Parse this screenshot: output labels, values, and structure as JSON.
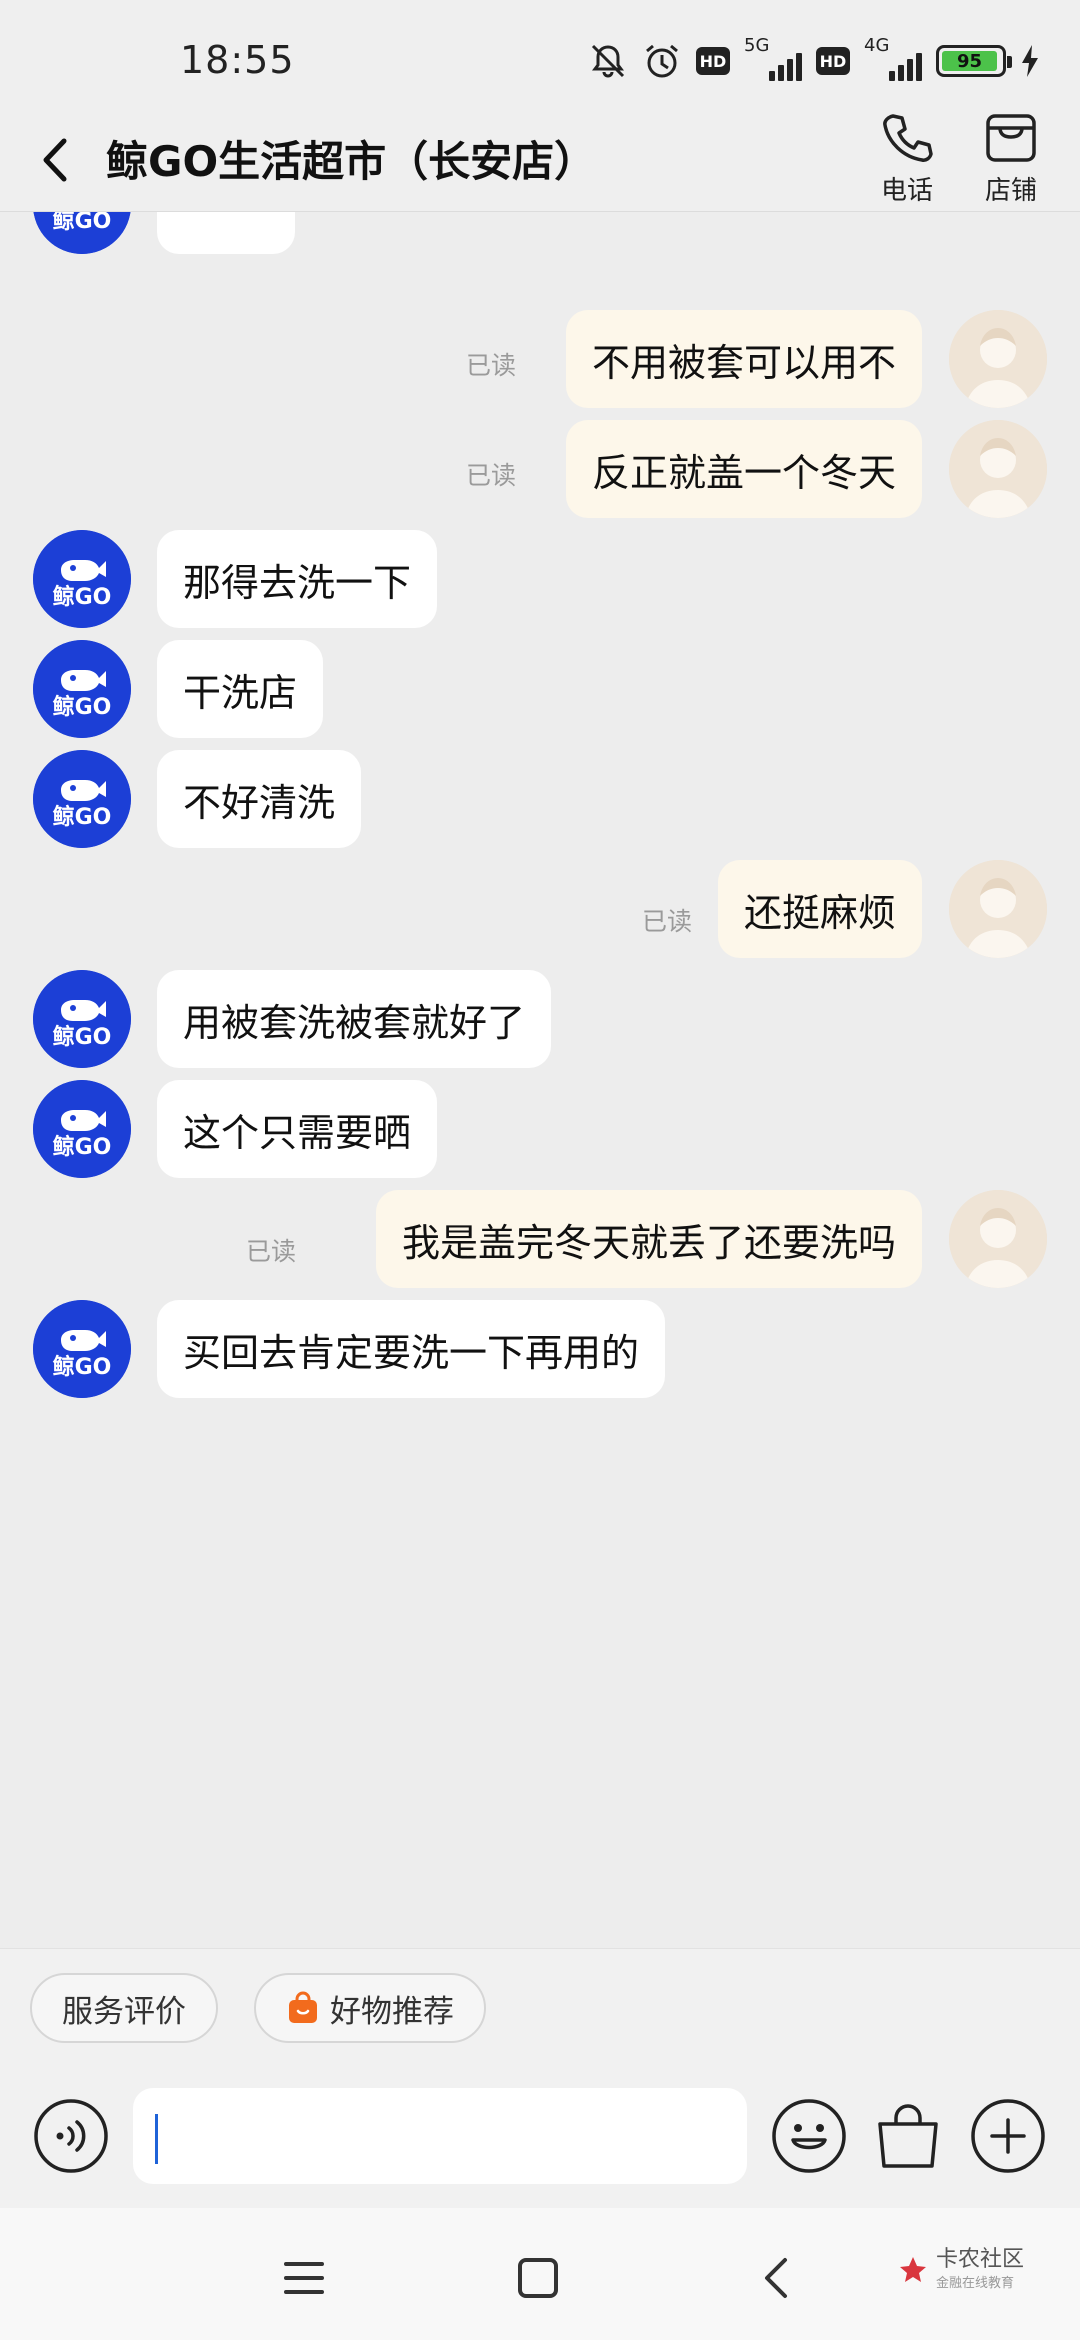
{
  "status_bar": {
    "time": "18:55",
    "net1": "5G",
    "net2": "4G",
    "hd": "HD",
    "battery": "95",
    "battery_color": "#4cc24a"
  },
  "header": {
    "title": "鲸GO生活超市（长安店）",
    "phone_label": "电话",
    "store_label": "店铺"
  },
  "store_logo_text": "鲸GO",
  "messages": [
    {
      "side": "out",
      "text": "不用被套可以用不",
      "read": "已读"
    },
    {
      "side": "out",
      "text": "反正就盖一个冬天",
      "read": "已读"
    },
    {
      "side": "in",
      "text": "那得去洗一下"
    },
    {
      "side": "in",
      "text": "干洗店"
    },
    {
      "side": "in",
      "text": "不好清洗"
    },
    {
      "side": "out",
      "text": "还挺麻烦",
      "read": "已读"
    },
    {
      "side": "in",
      "text": "用被套洗被套就好了"
    },
    {
      "side": "in",
      "text": "这个只需要晒"
    },
    {
      "side": "out",
      "text": "我是盖完冬天就丢了还要洗吗",
      "read": "已读"
    },
    {
      "side": "in",
      "text": "买回去肯定要洗一下再用的"
    }
  ],
  "chips": {
    "review": "服务评价",
    "recommend": "好物推荐"
  },
  "input": {
    "placeholder": ""
  },
  "colors": {
    "accent_blue": "#1c3fd6",
    "chip_orange": "#f26b1d",
    "incoming_bubble": "#ffffff",
    "outgoing_bubble": "#fdf7ea"
  },
  "watermark": {
    "title": "卡农社区",
    "subtitle": "金融在线教育"
  }
}
